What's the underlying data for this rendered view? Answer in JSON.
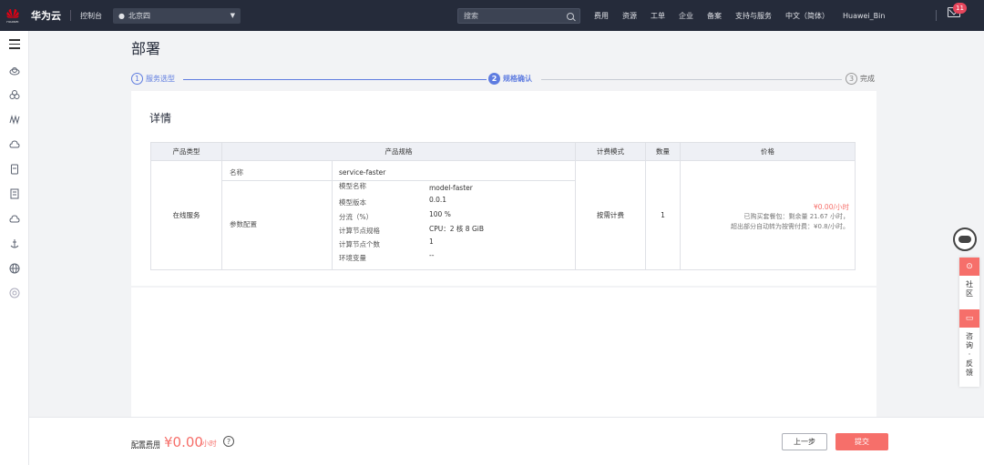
{
  "topbar": {
    "logo_text": "HUAWEI",
    "brand": "华为云",
    "console": "控制台",
    "region": "北京四",
    "search_placeholder": "搜索",
    "nav": [
      "费用",
      "资源",
      "工单",
      "企业",
      "备案",
      "支持与服务",
      "中文（简体）",
      "Huawei_Bin"
    ],
    "badge_count": "11"
  },
  "page": {
    "title": "部署",
    "steps": [
      {
        "num": "1",
        "label": "服务选型",
        "state": "done"
      },
      {
        "num": "2",
        "label": "规格确认",
        "state": "active"
      },
      {
        "num": "3",
        "label": "完成",
        "state": "pending"
      }
    ],
    "card_title": "详情"
  },
  "table": {
    "headers": [
      "产品类型",
      "产品规格",
      "计费模式",
      "数量",
      "价格"
    ],
    "product_type": "在线服务",
    "name_label": "名称",
    "name_value": "service-faster",
    "params_label": "参数配置",
    "params": [
      {
        "k": "模型名称",
        "v": "model-faster"
      },
      {
        "k": "模型版本",
        "v": "0.0.1"
      },
      {
        "k": "分流（%）",
        "v": "100 %"
      },
      {
        "k": "计算节点规格",
        "v": "CPU：2 核 8 GiB"
      },
      {
        "k": "计算节点个数",
        "v": "1"
      },
      {
        "k": "环境变量",
        "v": "--"
      }
    ],
    "billing": "按需计费",
    "quantity": "1",
    "price_main": "¥0.00/小时",
    "price_note1": "已购买套餐包：剩余量 21.67 小时，",
    "price_note2": "超出部分自动转为按需付费：¥0.8/小时。"
  },
  "footer": {
    "fee_label": "配置费用",
    "fee_amount": "¥0.00",
    "fee_unit": "/小时",
    "help": "?",
    "prev_label": "上一步",
    "submit_label": "提交"
  },
  "float": {
    "community": "社区",
    "feedback": "咨询·反馈"
  },
  "colors": {
    "accent": "#5e7ce0",
    "danger": "#f66f6a",
    "topbar": "#252b3a"
  }
}
